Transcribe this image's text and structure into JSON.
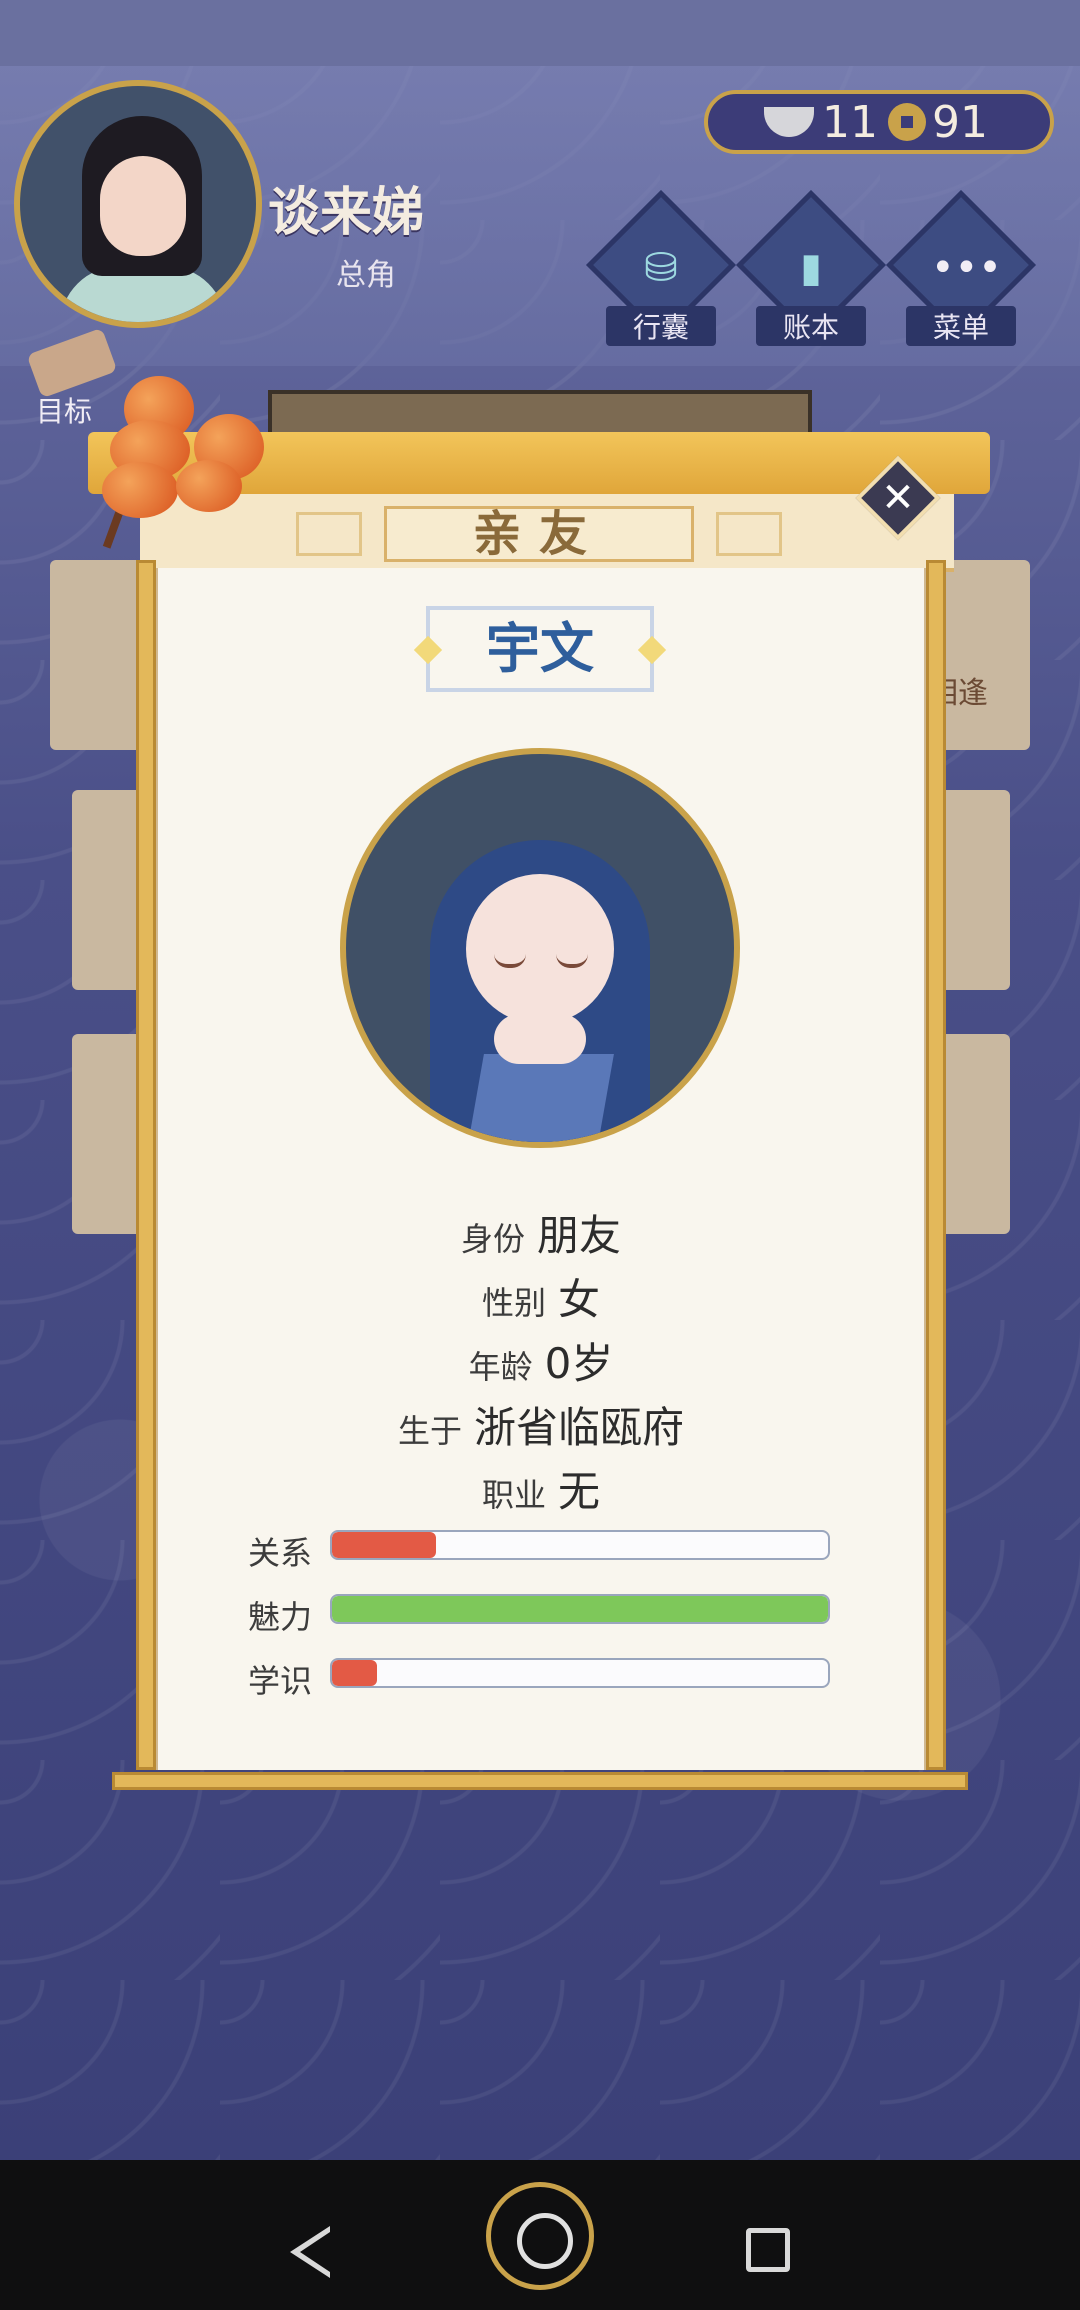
{
  "player": {
    "name": "谈来娣",
    "role": "总角"
  },
  "currency": {
    "silver": "11",
    "copper": "91"
  },
  "top_buttons": [
    {
      "label": "行囊",
      "icon": "bag-icon"
    },
    {
      "label": "账本",
      "icon": "ledger-icon"
    },
    {
      "label": "菜单",
      "icon": "menu-icon"
    }
  ],
  "goal": {
    "label": "目标"
  },
  "modal": {
    "title": "亲友",
    "npc_name": "宇文",
    "info": [
      {
        "key": "身份",
        "value": "朋友"
      },
      {
        "key": "性别",
        "value": "女"
      },
      {
        "key": "年龄",
        "value": "0岁"
      },
      {
        "key": "生于",
        "value": "浙省临瓯府"
      },
      {
        "key": "职业",
        "value": "无"
      }
    ],
    "bars": [
      {
        "key": "关系",
        "value": 0.21,
        "color": "#e35a45"
      },
      {
        "key": "魅力",
        "value": 1.0,
        "color": "#7ec85a"
      },
      {
        "key": "学识",
        "value": 0.09,
        "color": "#e35a45"
      }
    ]
  },
  "background_panel": {
    "title": "亲友",
    "side_text": "相逢"
  }
}
